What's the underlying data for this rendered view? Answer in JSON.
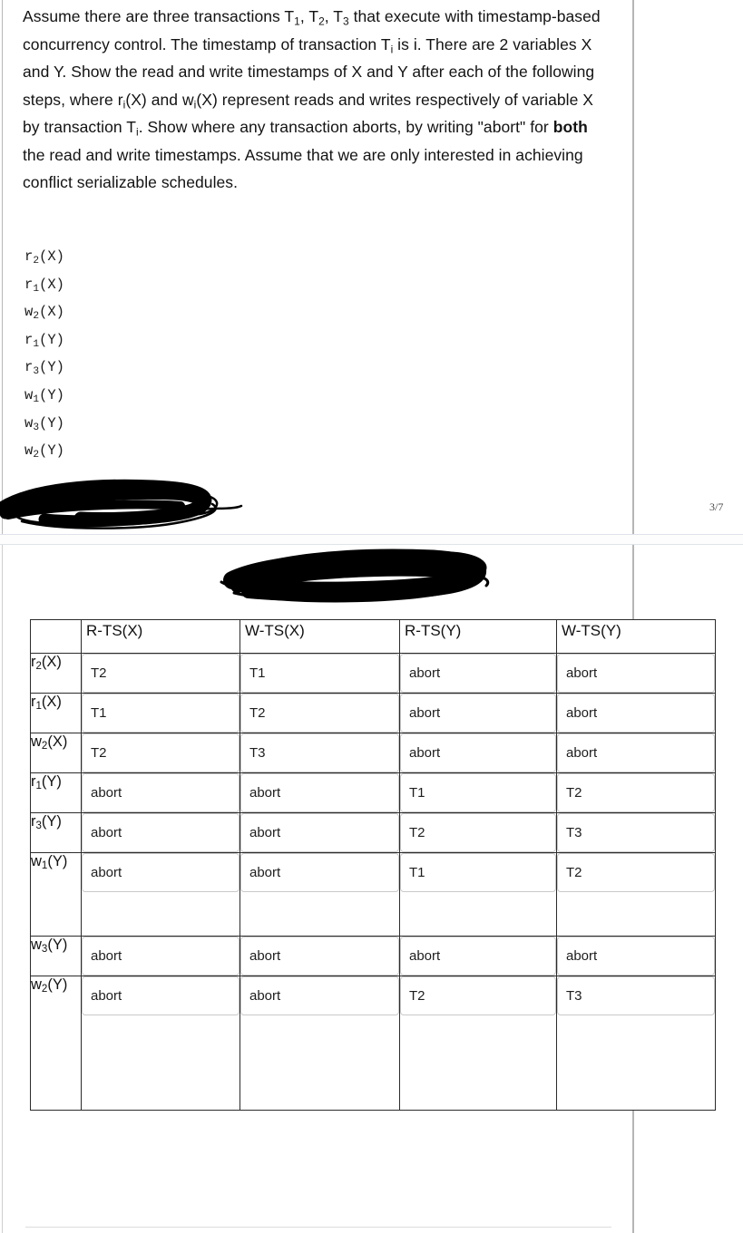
{
  "document": {
    "page_number": "3/7",
    "prompt_paragraph": "Assume there are three transactions T1, T2, T3 that execute with timestamp-based concurrency control. The timestamp of transaction Ti is i. There are 2 variables X and Y. Show the read and write timestamps of X and Y after each of the following steps, where ri(X) and wi(X) represent reads and writes respectively of variable X by transaction Ti. Show where any transaction aborts, by writing \"abort\" for both the read and write timestamps. Assume that we are only interested in achieving conflict serializable schedules."
  },
  "schedule": {
    "operations": [
      {
        "op": "r",
        "sub": "2",
        "var": "(X)"
      },
      {
        "op": "r",
        "sub": "1",
        "var": "(X)"
      },
      {
        "op": "w",
        "sub": "2",
        "var": "(X)"
      },
      {
        "op": "r",
        "sub": "1",
        "var": "(Y)"
      },
      {
        "op": "r",
        "sub": "3",
        "var": "(Y)"
      },
      {
        "op": "w",
        "sub": "1",
        "var": "(Y)"
      },
      {
        "op": "w",
        "sub": "3",
        "var": "(Y)"
      },
      {
        "op": "w",
        "sub": "2",
        "var": "(Y)"
      }
    ]
  },
  "table": {
    "headers": [
      "",
      "R-TS(X)",
      "W-TS(X)",
      "R-TS(Y)",
      "W-TS(Y)"
    ],
    "rows": [
      {
        "label_op": "r",
        "label_sub": "2",
        "label_var": "(X)",
        "values": [
          "T2",
          "T1",
          "abort",
          "abort"
        ]
      },
      {
        "label_op": "r",
        "label_sub": "1",
        "label_var": "(X)",
        "values": [
          "T1",
          "T2",
          "abort",
          "abort"
        ]
      },
      {
        "label_op": "w",
        "label_sub": "2",
        "label_var": "(X)",
        "values": [
          "T2",
          "T3",
          "abort",
          "abort"
        ]
      },
      {
        "label_op": "r",
        "label_sub": "1",
        "label_var": "(Y)",
        "values": [
          "abort",
          "abort",
          "T1",
          "T2"
        ]
      },
      {
        "label_op": "r",
        "label_sub": "3",
        "label_var": "(Y)",
        "values": [
          "abort",
          "abort",
          "T2",
          "T3"
        ]
      },
      {
        "label_op": "w",
        "label_sub": "1",
        "label_var": "(Y)",
        "values": [
          "abort",
          "abort",
          "T1",
          "T2"
        ]
      },
      {
        "label_op": "w",
        "label_sub": "3",
        "label_var": "(Y)",
        "values": [
          "abort",
          "abort",
          "abort",
          "abort"
        ]
      },
      {
        "label_op": "w",
        "label_sub": "2",
        "label_var": "(Y)",
        "values": [
          "abort",
          "abort",
          "T2",
          "T3"
        ]
      }
    ]
  },
  "annotations": {
    "redaction_marks": [
      "scribble-upper-left",
      "scribble-header"
    ]
  }
}
